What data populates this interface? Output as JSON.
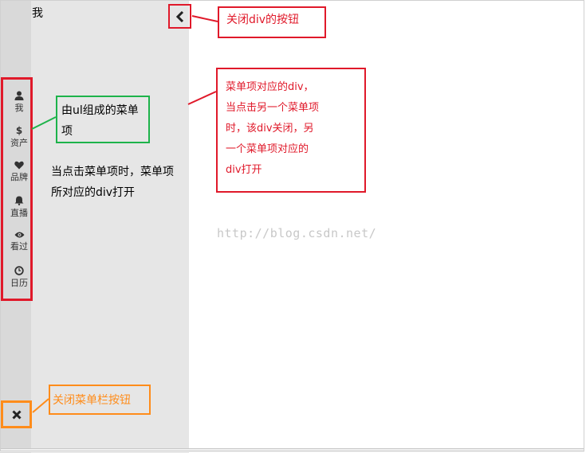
{
  "panel": {
    "title": "我"
  },
  "menu": {
    "items": [
      {
        "label": "我",
        "icon": "user-icon"
      },
      {
        "label": "资产",
        "icon": "dollar-icon"
      },
      {
        "label": "品牌",
        "icon": "heart-icon"
      },
      {
        "label": "直播",
        "icon": "bell-icon"
      },
      {
        "label": "看过",
        "icon": "eye-icon"
      },
      {
        "label": "日历",
        "icon": "clock-icon"
      }
    ]
  },
  "annotations": {
    "close_div_button": "关闭div的按钮",
    "ul_menu_items": "由ul组成的菜单项",
    "click_behavior": "当点击菜单项时，菜单项所对应的div打开",
    "menu_div_lines": [
      "菜单项对应的div，",
      "当点击另一个菜单项",
      "时，该div关闭，另",
      "一个菜单项对应的",
      "div打开"
    ],
    "close_menu_button": "关闭菜单栏按钮"
  },
  "watermark": "http://blog.csdn.net/",
  "colors": {
    "annotation_red": "#e0192a",
    "annotation_green": "#1db34a",
    "annotation_orange": "#ff8c1a",
    "sidebar": "#d9d9d9",
    "panel": "#e6e6e6"
  }
}
